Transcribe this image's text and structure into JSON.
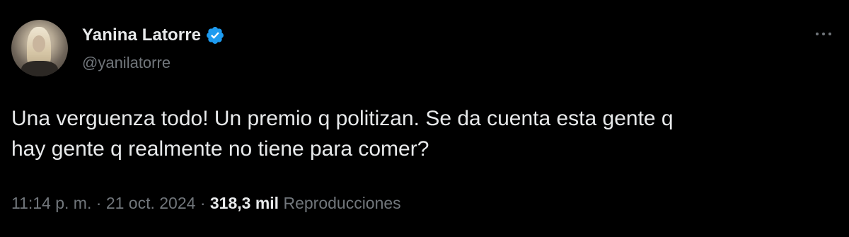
{
  "author": {
    "display_name": "Yanina Latorre",
    "handle": "@yanilatorre",
    "verified": true,
    "avatar_icon": "user-avatar"
  },
  "tweet": {
    "text_lines": [
      "Una verguenza todo! Un premio q politizan. Se da cuenta esta gente q",
      "hay gente q realmente no tiene para comer?"
    ]
  },
  "meta": {
    "time": "11:14 p. m.",
    "separator": "·",
    "date": "21 oct. 2024",
    "views_count": "318,3 mil",
    "views_label": "Reproducciones"
  },
  "icons": {
    "more": "more-horizontal-icon",
    "verified": "verified-badge-icon"
  },
  "colors": {
    "background": "#000000",
    "primary_text": "#e7e9ea",
    "secondary_text": "#71767b",
    "verified_blue": "#1d9bf0"
  }
}
